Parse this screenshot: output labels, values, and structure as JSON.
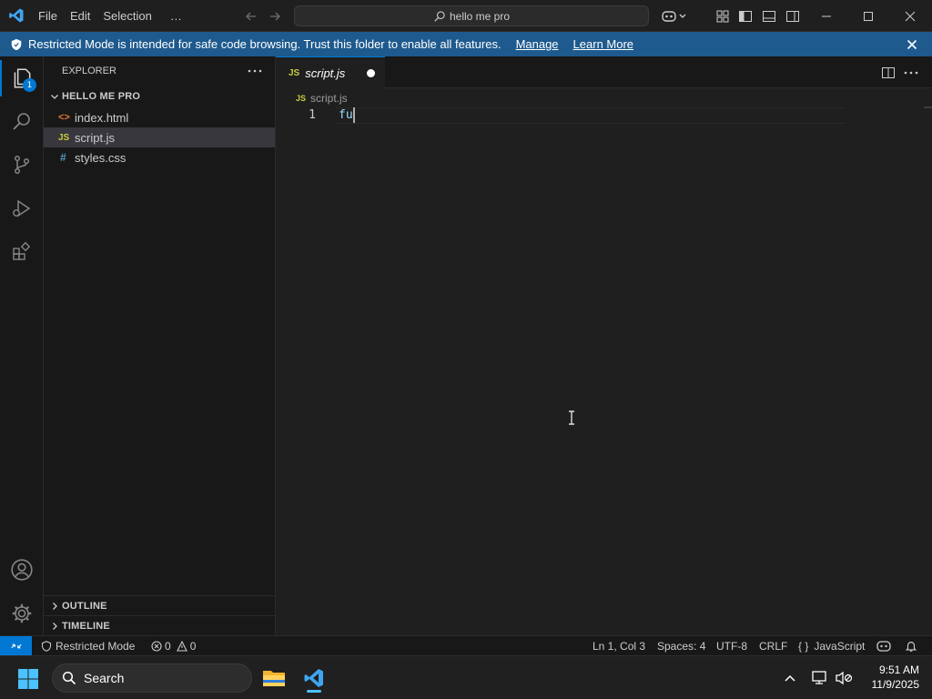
{
  "titlebar": {
    "menu": [
      "File",
      "Edit",
      "Selection"
    ],
    "more": "…",
    "command_center": "hello me pro"
  },
  "banner": {
    "message": "Restricted Mode is intended for safe code browsing. Trust this folder to enable all features.",
    "manage": "Manage",
    "learn_more": "Learn More"
  },
  "activity": {
    "explorer_badge": "1"
  },
  "sidebar": {
    "title": "EXPLORER",
    "folder": "HELLO ME PRO",
    "files": [
      {
        "icon": "<>",
        "name": "index.html",
        "color": "#e37933"
      },
      {
        "icon": "JS",
        "name": "script.js",
        "color": "#cbcb41"
      },
      {
        "icon": "#",
        "name": "styles.css",
        "color": "#519aba"
      }
    ],
    "outline": "OUTLINE",
    "timeline": "TIMELINE"
  },
  "editor": {
    "tab_icon": "JS",
    "tab_label": "script.js",
    "breadcrumb_icon": "JS",
    "breadcrumb": "script.js",
    "line_number": "1",
    "code": "fu"
  },
  "statusbar": {
    "restricted": "Restricted Mode",
    "errors": "0",
    "warnings": "0",
    "position": "Ln 1, Col 3",
    "spaces": "Spaces: 4",
    "encoding": "UTF-8",
    "eol": "CRLF",
    "language": "JavaScript"
  },
  "taskbar": {
    "search": "Search",
    "time": "9:51 AM",
    "date": "11/9/2025"
  },
  "colors": {
    "accent": "#0078d4",
    "banner": "#1e5a8e",
    "remote": "#0078d4"
  }
}
